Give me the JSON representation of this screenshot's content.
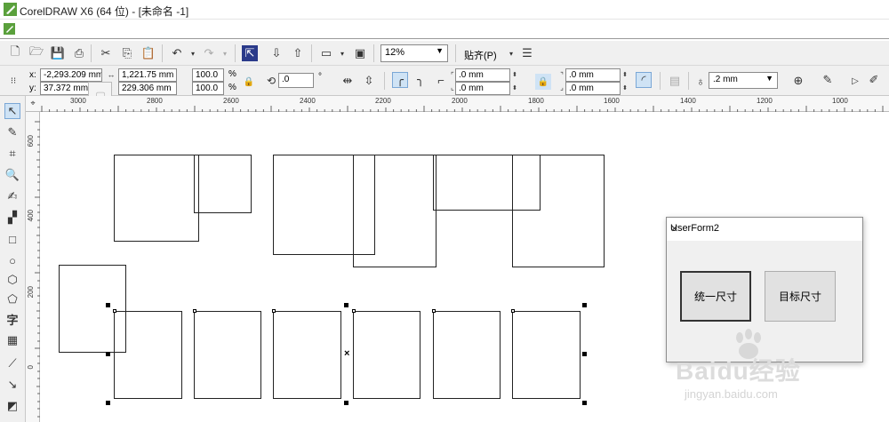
{
  "app": {
    "title": "CorelDRAW X6 (64 位) - [未命名 -1]"
  },
  "toolbar": {
    "zoom": "12%",
    "snap_label": "贴齐(P)"
  },
  "property_bar": {
    "x_label": "x:",
    "y_label": "y:",
    "x_value": "-2,293.209 mm",
    "y_value": "37.372 mm",
    "width_value": "1,221.75 mm",
    "height_value": "229.306 mm",
    "scale_w": "100.0",
    "scale_h": "100.0",
    "percent": "%",
    "rotation": ".0",
    "degree": "°",
    "corner1": ".0 mm",
    "corner2": ".0 mm",
    "corner3": ".0 mm",
    "corner4": ".0 mm",
    "outline_width": ".2 mm"
  },
  "rulers": {
    "h_ticks": [
      "3000",
      "2800",
      "2600",
      "2400",
      "2200",
      "2000",
      "1800",
      "1600",
      "1400",
      "1200",
      "1000"
    ],
    "v_ticks": [
      "600",
      "400",
      "200",
      "0"
    ]
  },
  "dialog": {
    "title": "UserForm2",
    "close": "✕",
    "btn_unify": "统一尺寸",
    "btn_target": "目标尺寸"
  },
  "watermark": {
    "brand": "Baidu经验",
    "url": "jingyan.baidu.com"
  },
  "left_tools": {
    "text_tool": "字"
  }
}
